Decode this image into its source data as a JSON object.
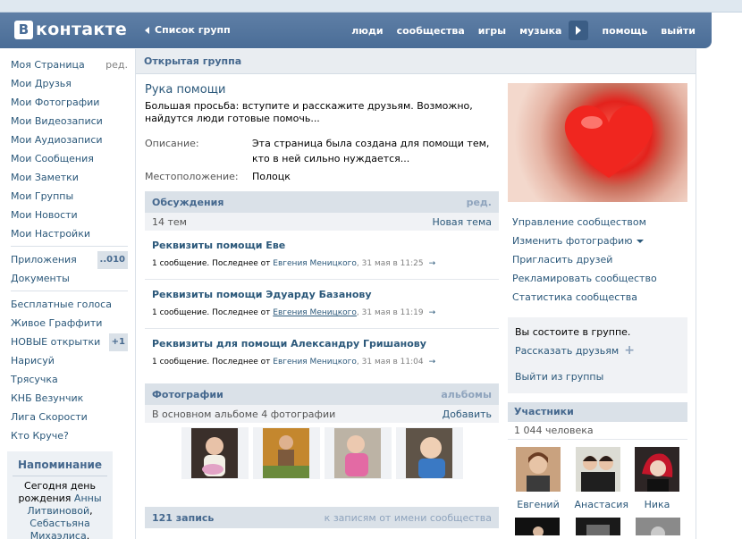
{
  "header": {
    "logo_letter": "В",
    "logo_text": "контакте",
    "back_link": "Список групп",
    "nav": [
      "люди",
      "сообщества",
      "игры",
      "музыка",
      "помощь",
      "выйти"
    ]
  },
  "left_menu": {
    "items": [
      {
        "label": "Моя Страница",
        "extra": "ред."
      },
      {
        "label": "Мои Друзья"
      },
      {
        "label": "Мои Фотографии"
      },
      {
        "label": "Мои Видеозаписи"
      },
      {
        "label": "Мои Аудиозаписи"
      },
      {
        "label": "Мои Сообщения"
      },
      {
        "label": "Мои Заметки"
      },
      {
        "label": "Мои Группы"
      },
      {
        "label": "Мои Новости"
      },
      {
        "label": "Мои Настройки"
      }
    ],
    "apps": [
      {
        "label": "Приложения",
        "badge": "..010"
      },
      {
        "label": "Документы"
      }
    ],
    "extra_apps": [
      {
        "label": "Бесплатные голоса"
      },
      {
        "label": "Живое Граффити"
      },
      {
        "label": "НОВЫЕ открытки",
        "badge": "+1"
      },
      {
        "label": "Нарисуй"
      },
      {
        "label": "Трясучка"
      },
      {
        "label": "КНБ Везунчик"
      },
      {
        "label": "Лига Скорости"
      },
      {
        "label": "Кто Круче?"
      }
    ]
  },
  "reminder": {
    "title": "Напоминание",
    "text_before": "Сегодня день рождения",
    "name1": "Анны Литвиновой",
    "sep": ",",
    "name2": "Себастьяна Михаэлиса",
    "end": "."
  },
  "page_bar": "Открытая группа",
  "group": {
    "title": "Рука помощи",
    "status": "Большая просьба: вступите и расскажите друзьям. Возможно, найдутся люди готовые помочь...",
    "info": [
      {
        "label": "Описание:",
        "value": "Эта страница была создана для помощи тем, кто в ней сильно нуждается..."
      },
      {
        "label": "Местоположение:",
        "value": "Полоцк"
      }
    ]
  },
  "discussions": {
    "title": "Обсуждения",
    "edit": "ред.",
    "count": "14 тем",
    "new_topic": "Новая тема",
    "topics": [
      {
        "title": "Реквизиты помощи Еве",
        "meta": "1 сообщение. Последнее от",
        "author": "Евгения Меницкого",
        "date": ", 31 мая в 11:25",
        "underline": false
      },
      {
        "title": "Реквизиты помощи Эдуарду Базанову",
        "meta": "1 сообщение. Последнее от",
        "author": "Евгения Меницкого",
        "date": ", 31 мая в 11:19",
        "underline": true
      },
      {
        "title": "Реквизиты для помощи Александру Гришанову",
        "meta": "1 сообщение. Последнее от",
        "author": "Евгения Меницкого",
        "date": ", 31 мая в 11:04",
        "underline": false
      }
    ]
  },
  "photos": {
    "title": "Фотографии",
    "albums": "альбомы",
    "caption": "В основном альбоме 4 фотографии",
    "add": "Добавить"
  },
  "records": {
    "title": "121 запись",
    "link": "к записям от имени сообщества"
  },
  "side": {
    "actions": [
      "Управление сообществом",
      "Изменить фотографию",
      "Пригласить друзей",
      "Рекламировать сообщество",
      "Статистика сообщества"
    ],
    "member_text": "Вы состоите в группе.",
    "tell_friends": "Рассказать друзьям",
    "leave": "Выйти из группы",
    "members_title": "Участники",
    "members_count": "1 044 человека",
    "members": [
      "Евгений",
      "Анастасия",
      "Ника"
    ]
  },
  "colors": {
    "header": "#4a6d97",
    "link": "#2b587a",
    "section": "#dae1e8"
  }
}
